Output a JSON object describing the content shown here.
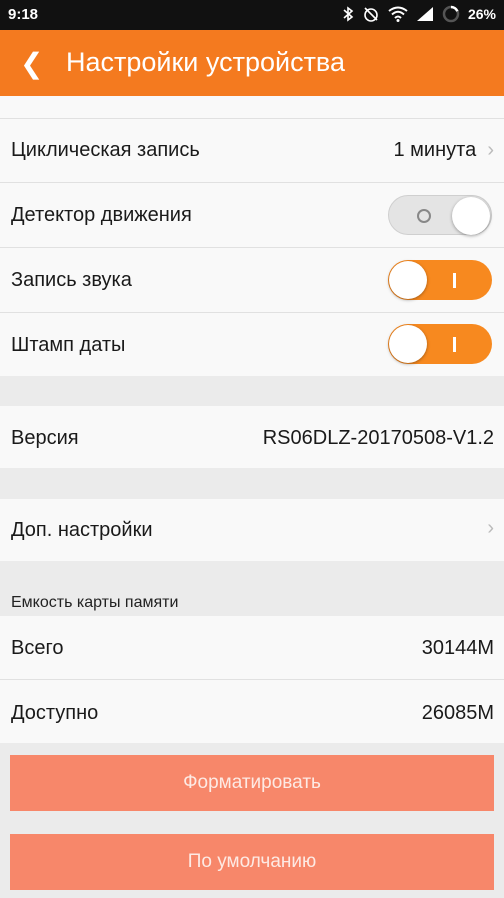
{
  "statusbar": {
    "time": "9:18",
    "battery": "26%"
  },
  "header": {
    "back_glyph": "❮",
    "title": "Настройки устройства"
  },
  "settings": {
    "loop_label": "Циклическая запись",
    "loop_value": "1 минута",
    "motion_label": "Детектор движения",
    "motion_state": "off",
    "audio_label": "Запись звука",
    "audio_state": "on",
    "stamp_label": "Штамп даты",
    "stamp_state": "on"
  },
  "version": {
    "label": "Версия",
    "value": "RS06DLZ-20170508-V1.2"
  },
  "advanced": {
    "label": "Доп. настройки"
  },
  "storage": {
    "section_label": "Емкость карты памяти",
    "total_label": "Всего",
    "total_value": "30144M",
    "free_label": "Доступно",
    "free_value": "26085M"
  },
  "buttons": {
    "format": "Форматировать",
    "default": "По умолчанию"
  },
  "colors": {
    "accent": "#f47a1f",
    "button": "#f7876a",
    "toggle_on": "#f7891f"
  },
  "icons": [
    "bluetooth-icon",
    "alarm-off-icon",
    "wifi-icon",
    "signal-icon",
    "battery-icon",
    "chevron-right-icon",
    "back-icon"
  ]
}
